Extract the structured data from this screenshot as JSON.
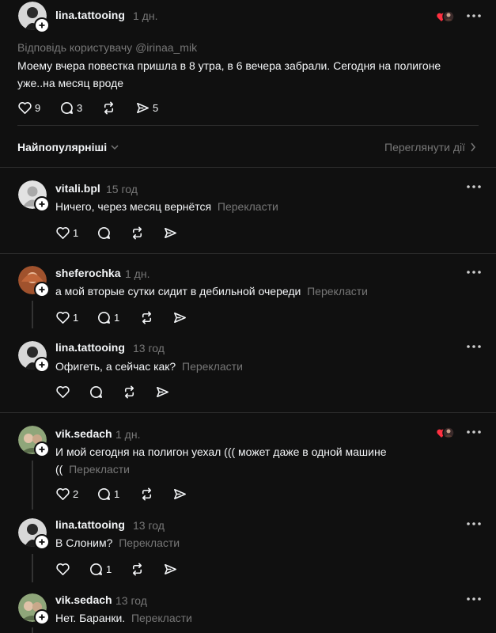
{
  "post": {
    "username": "lina.tattooing",
    "time": "1 дн.",
    "reply_to": "Відповідь користувачу @irinaa_mik",
    "text_line1": "Моему вчера повестка пришла в 8 утра, в 6 вечера забрали. Сегодня на полигоне",
    "text_line2": "уже..на месяц вроде",
    "likes": "9",
    "comments": "3",
    "shares": "5"
  },
  "sort": {
    "label": "Найпопулярніші",
    "view_activity": "Переглянути дії"
  },
  "translate_label": "Перекласти",
  "replies": [
    {
      "username": "vitali.bpl",
      "time": "15 год",
      "text": "Ничего, через месяц вернётся",
      "likes": "1",
      "comments": ""
    },
    {
      "username": "sheferochka",
      "time": "1 дн.",
      "text": "а мой вторые сутки сидит в дебильной очереди",
      "likes": "1",
      "comments": "1"
    },
    {
      "username": "lina.tattooing",
      "time": "13 год",
      "text": "Офигеть, а сейчас как?",
      "likes": "",
      "comments": ""
    },
    {
      "username": "vik.sedach",
      "time": "1 дн.",
      "text_line1": "И мой сегодня на полигон уехал ((( может даже в одной машине",
      "text_line2": "((",
      "likes": "2",
      "comments": "1"
    },
    {
      "username": "lina.tattooing",
      "time": "13 год",
      "text": "В Слоним?",
      "likes": "",
      "comments": "1"
    },
    {
      "username": "vik.sedach",
      "time": "13 год",
      "text": "Нет. Баранки."
    }
  ],
  "colors": {
    "background": "#101010",
    "text": "#f3f5f7",
    "muted": "#777777",
    "divider": "#2d2d2d",
    "heart_red": "#ff3040"
  }
}
